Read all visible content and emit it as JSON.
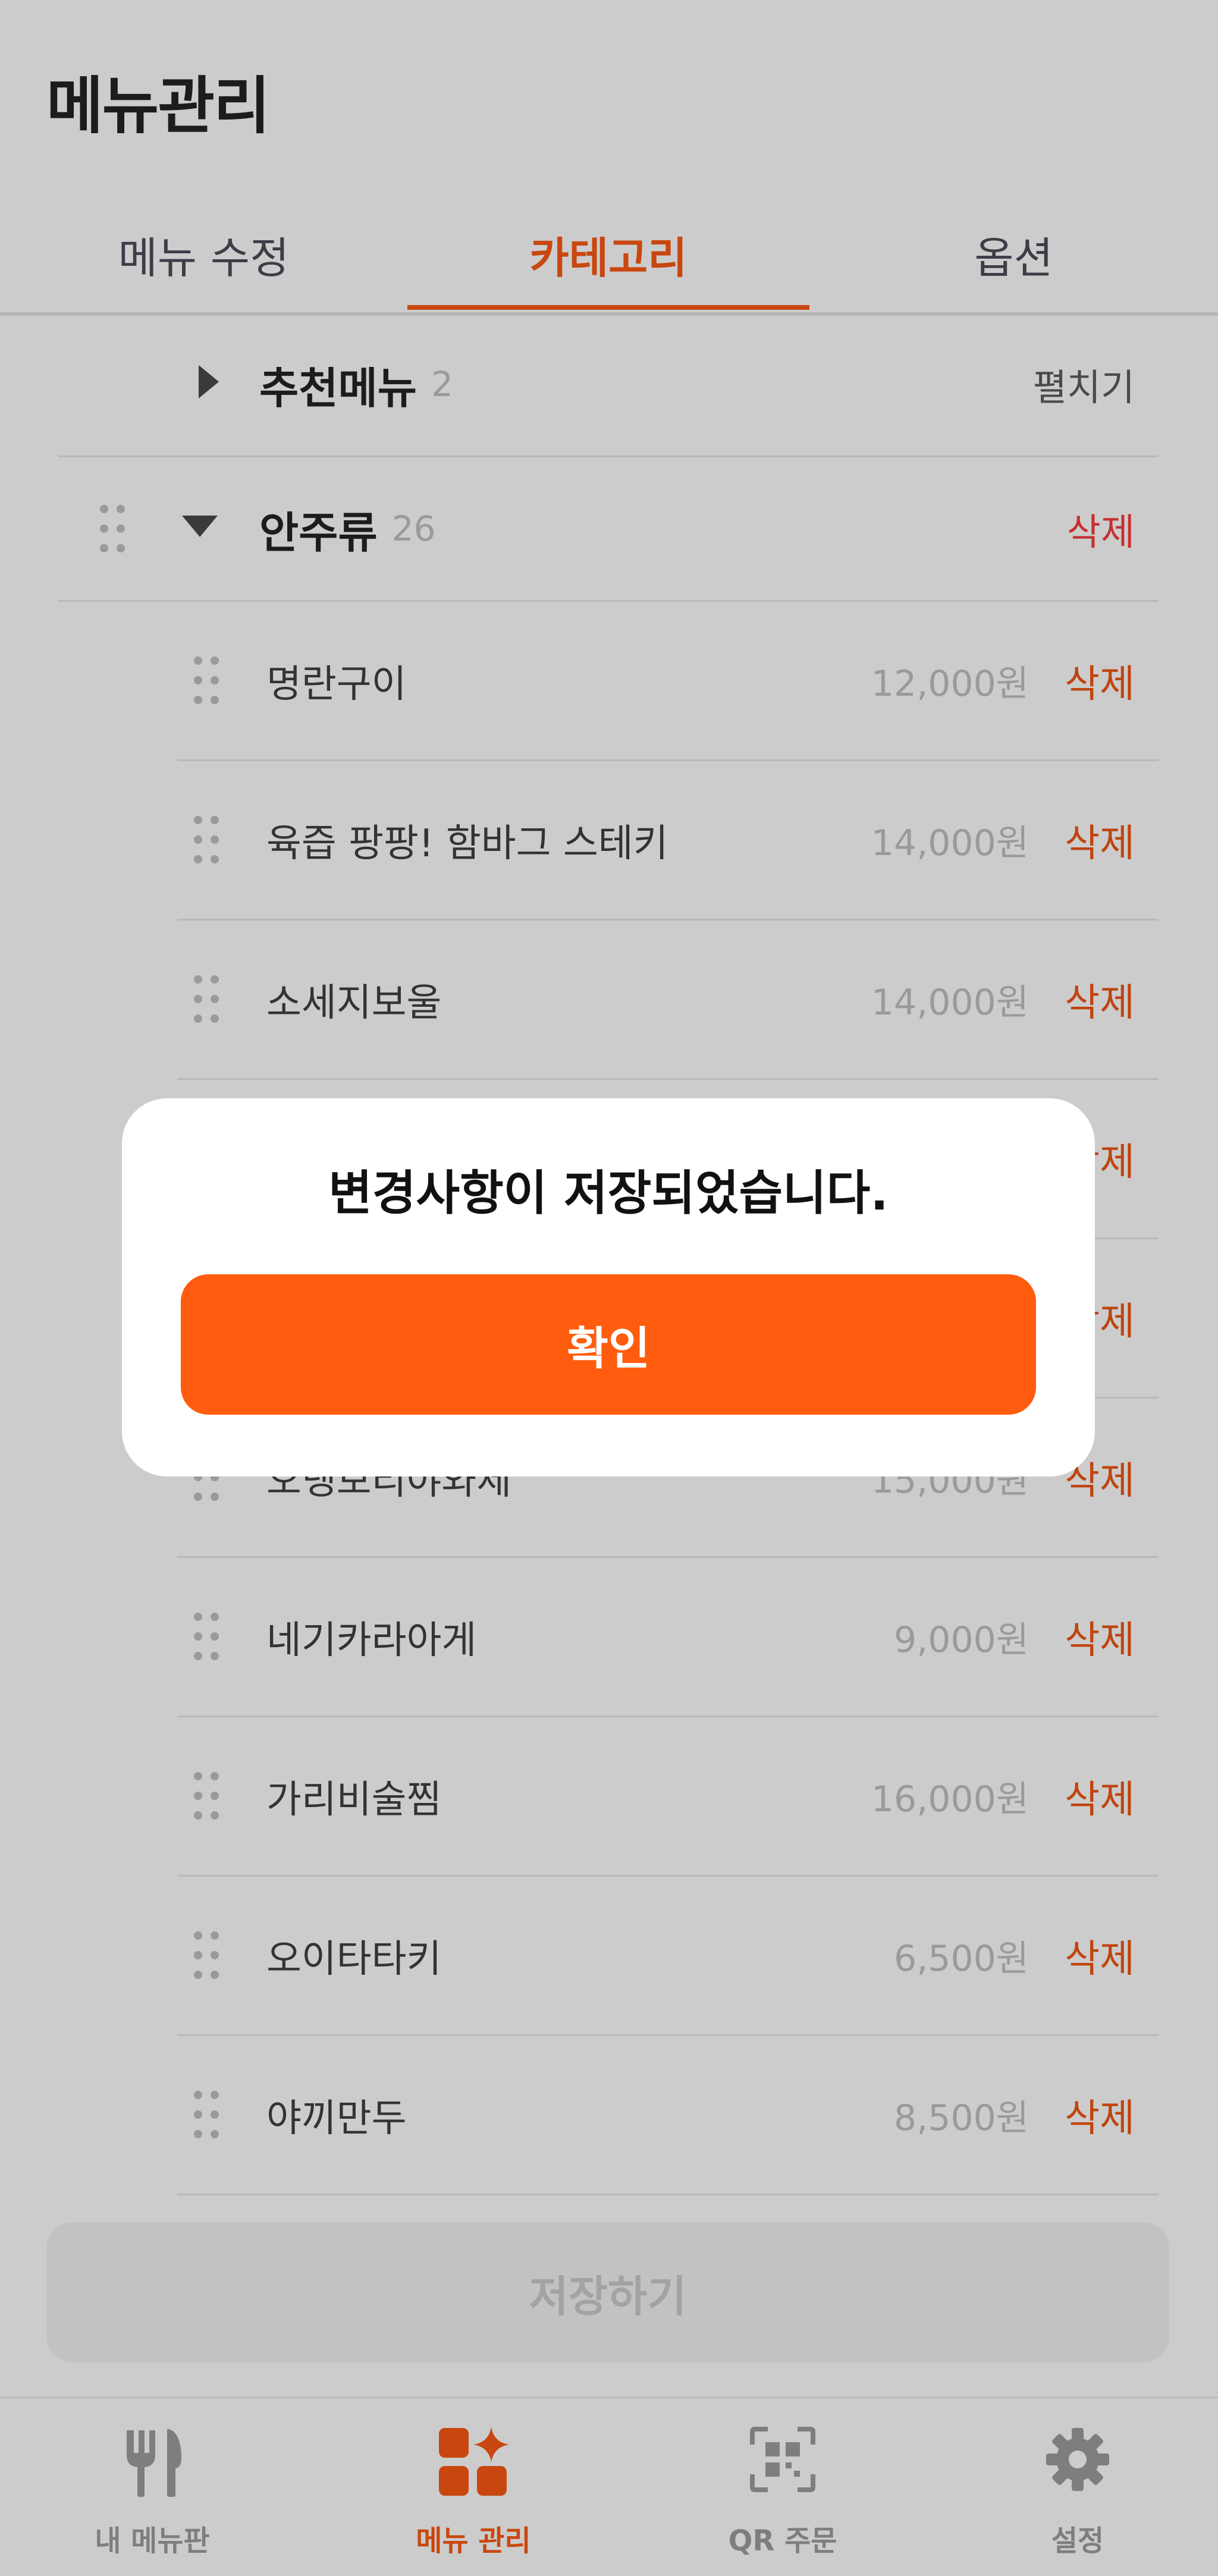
{
  "header": {
    "title": "메뉴관리"
  },
  "tabs": [
    {
      "label": "메뉴 수정",
      "active": false
    },
    {
      "label": "카테고리",
      "active": true
    },
    {
      "label": "옵션",
      "active": false
    }
  ],
  "categories": [
    {
      "name": "추천메뉴",
      "count": "2",
      "action": "펼치기",
      "expanded": false
    },
    {
      "name": "안주류",
      "count": "26",
      "action": "삭제",
      "expanded": true
    }
  ],
  "menu_items": [
    {
      "name": "명란구이",
      "price": "12,000원",
      "delete_label": "삭제"
    },
    {
      "name": "육즙 팡팡! 함바그 스테키",
      "price": "14,000원",
      "delete_label": "삭제"
    },
    {
      "name": "소세지보울",
      "price": "14,000원",
      "delete_label": "삭제"
    },
    {
      "name": "",
      "price": "",
      "delete_label": "삭제"
    },
    {
      "name": "",
      "price": "",
      "delete_label": "삭제"
    },
    {
      "name": "오넹보리야와세",
      "price": "15,000원",
      "delete_label": "삭제"
    },
    {
      "name": "네기카라아게",
      "price": "9,000원",
      "delete_label": "삭제"
    },
    {
      "name": "가리비술찜",
      "price": "16,000원",
      "delete_label": "삭제"
    },
    {
      "name": "오이타타키",
      "price": "6,500원",
      "delete_label": "삭제"
    },
    {
      "name": "야끼만두",
      "price": "8,500원",
      "delete_label": "삭제"
    }
  ],
  "save_button": {
    "label": "저장하기"
  },
  "bottom_nav": [
    {
      "label": "내 메뉴판",
      "icon": "fork-knife-icon",
      "active": false
    },
    {
      "label": "메뉴 관리",
      "icon": "menu-manage-icon",
      "active": true
    },
    {
      "label": "QR 주문",
      "icon": "qr-code-icon",
      "active": false
    },
    {
      "label": "설정",
      "icon": "gear-icon",
      "active": false
    }
  ],
  "dialog": {
    "message": "변경사항이 저장되었습니다.",
    "confirm_label": "확인"
  },
  "colors": {
    "accent": "#c9470f",
    "confirm_button": "#ff5c0f",
    "delete_red": "#c72f2f",
    "overlay_background": "#cccccc",
    "dialog_background": "#ffffff"
  }
}
